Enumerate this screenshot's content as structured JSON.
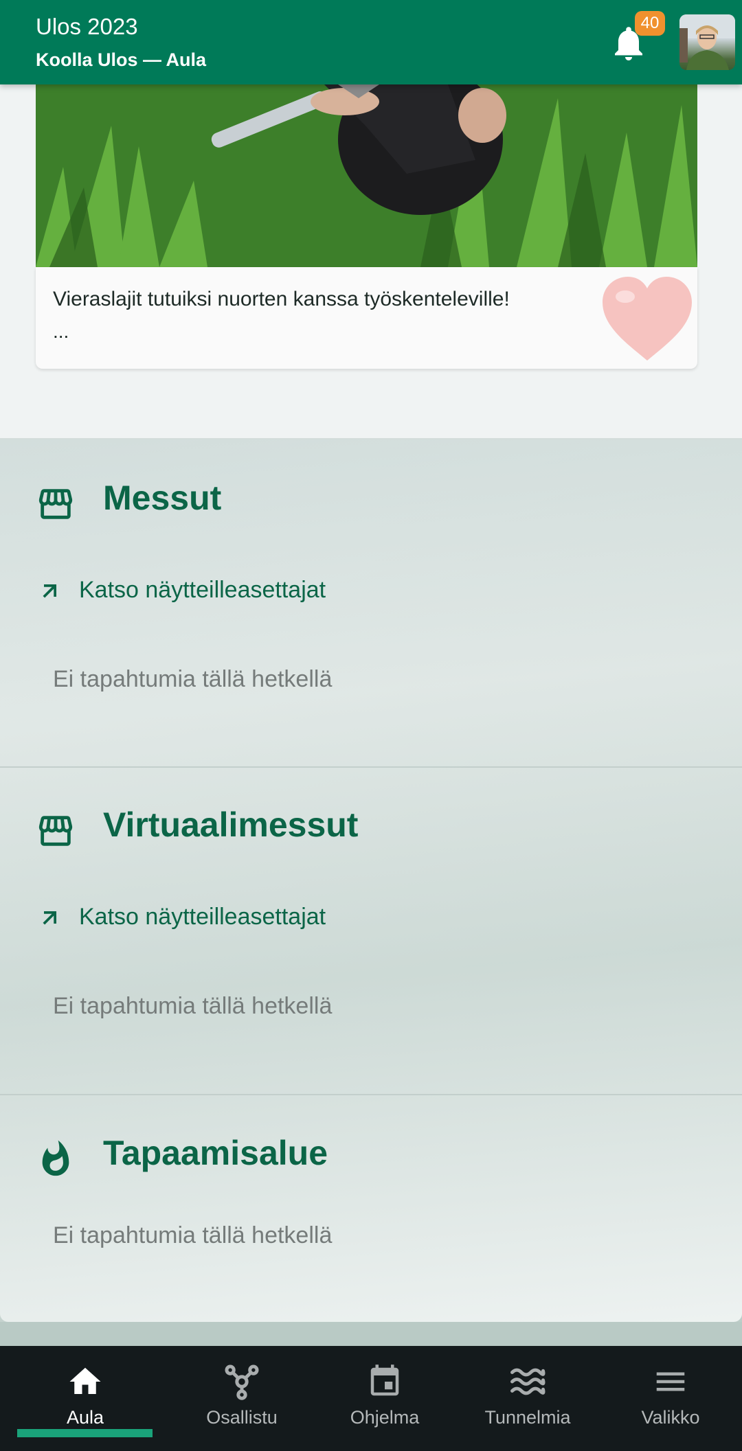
{
  "header": {
    "title": "Ulos 2023",
    "subtitle": "Koolla Ulos — Aula",
    "notification_count": "40",
    "bell_icon": "bell-icon",
    "avatar_icon": "user-avatar"
  },
  "news_card": {
    "text": "Vieraslajit tutuiksi nuorten kanssa työskenteleville!",
    "more": "...",
    "heart_icon": "heart-icon"
  },
  "sections": [
    {
      "icon": "storefront-icon",
      "title": "Messut",
      "link_label": "Katso näytteilleasettajat",
      "empty_text": "Ei tapahtumia tällä hetkellä"
    },
    {
      "icon": "storefront-icon",
      "title": "Virtuaalimessut",
      "link_label": "Katso näytteilleasettajat",
      "empty_text": "Ei tapahtumia tällä hetkellä"
    },
    {
      "icon": "flame-icon",
      "title": "Tapaamisalue",
      "empty_text": "Ei tapahtumia tällä hetkellä"
    }
  ],
  "bottom_nav": {
    "items": [
      {
        "label": "Aula",
        "icon": "home-icon",
        "active": true
      },
      {
        "label": "Osallistu",
        "icon": "hub-icon",
        "active": false
      },
      {
        "label": "Ohjelma",
        "icon": "calendar-icon",
        "active": false
      },
      {
        "label": "Tunnelmia",
        "icon": "waves-icon",
        "active": false
      },
      {
        "label": "Valikko",
        "icon": "menu-icon",
        "active": false
      }
    ]
  },
  "colors": {
    "brand_green": "#007a58",
    "title_green": "#0b6547",
    "badge_orange": "#f0912e",
    "nav_background": "#141a1c",
    "nav_indicator": "#1aa37a"
  }
}
